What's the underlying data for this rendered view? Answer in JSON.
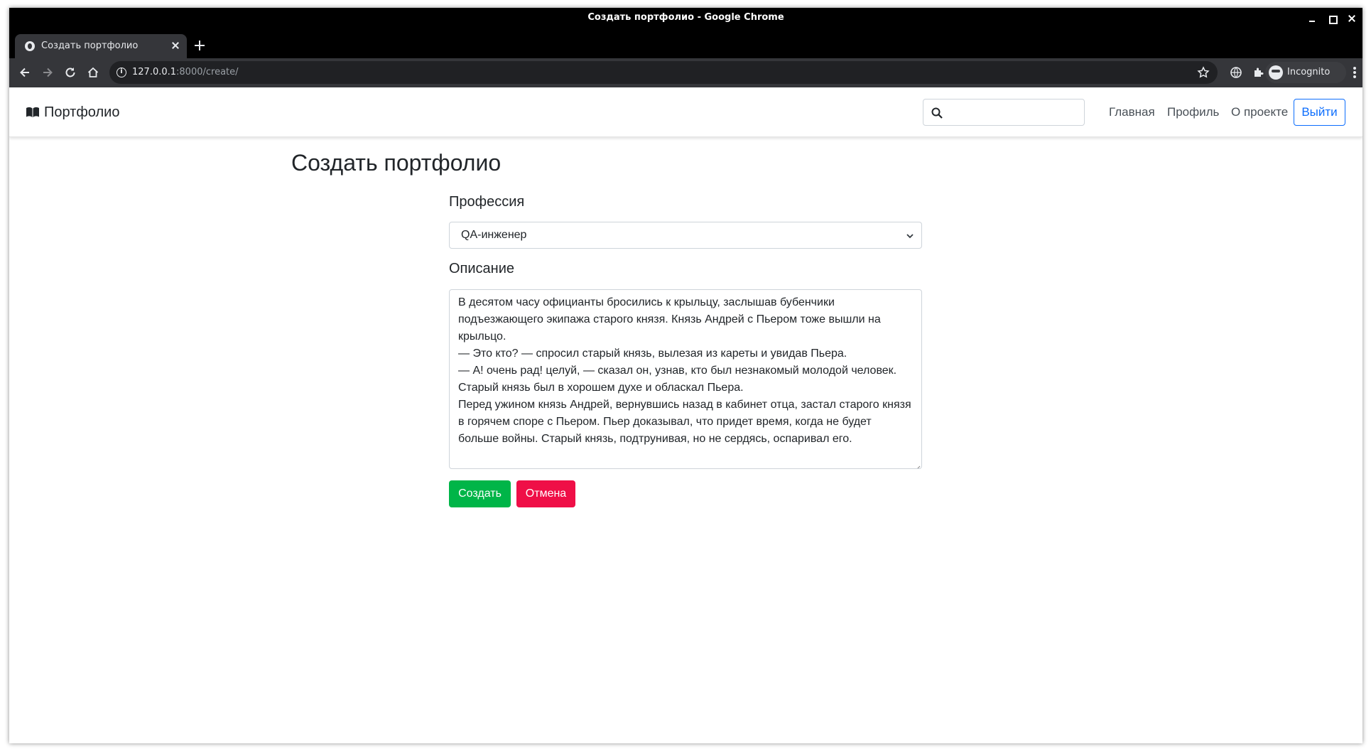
{
  "window": {
    "title": "Создать портфолио - Google Chrome"
  },
  "browser": {
    "tab_title": "Создать портфолио",
    "url_host": "127.0.0.1",
    "url_path": ":8000/create/",
    "incognito_label": "Incognito"
  },
  "navbar": {
    "brand": "Портфолио",
    "search_placeholder": "",
    "links": [
      "Главная",
      "Профиль",
      "О проекте"
    ],
    "logout_label": "Выйти"
  },
  "form": {
    "heading": "Создать портфолио",
    "profession_label": "Профессия",
    "profession_value": "QA-инженер",
    "description_label": "Описание",
    "description_value": "В десятом часу официанты бросились к крыльцу, заслышав бубенчики подъезжающего экипажа старого князя. Князь Андрей с Пьером тоже вышли на крыльцо.\n— Это кто? — спросил старый князь, вылезая из кареты и увидав Пьера.\n— А! очень рад! целуй, — сказал он, узнав, кто был незнакомый молодой человек.\nСтарый князь был в хорошем духе и обласкал Пьера.\nПеред ужином князь Андрей, вернувшись назад в кабинет отца, застал старого князя в горячем споре с Пьером. Пьер доказывал, что придет время, когда не будет больше войны. Старый князь, подтрунивая, но не сердясь, оспаривал его.",
    "create_label": "Создать",
    "cancel_label": "Отмена"
  },
  "colors": {
    "create_button": "#00b548",
    "cancel_button": "#ef0f47",
    "logout_outline": "#0d6efd"
  }
}
